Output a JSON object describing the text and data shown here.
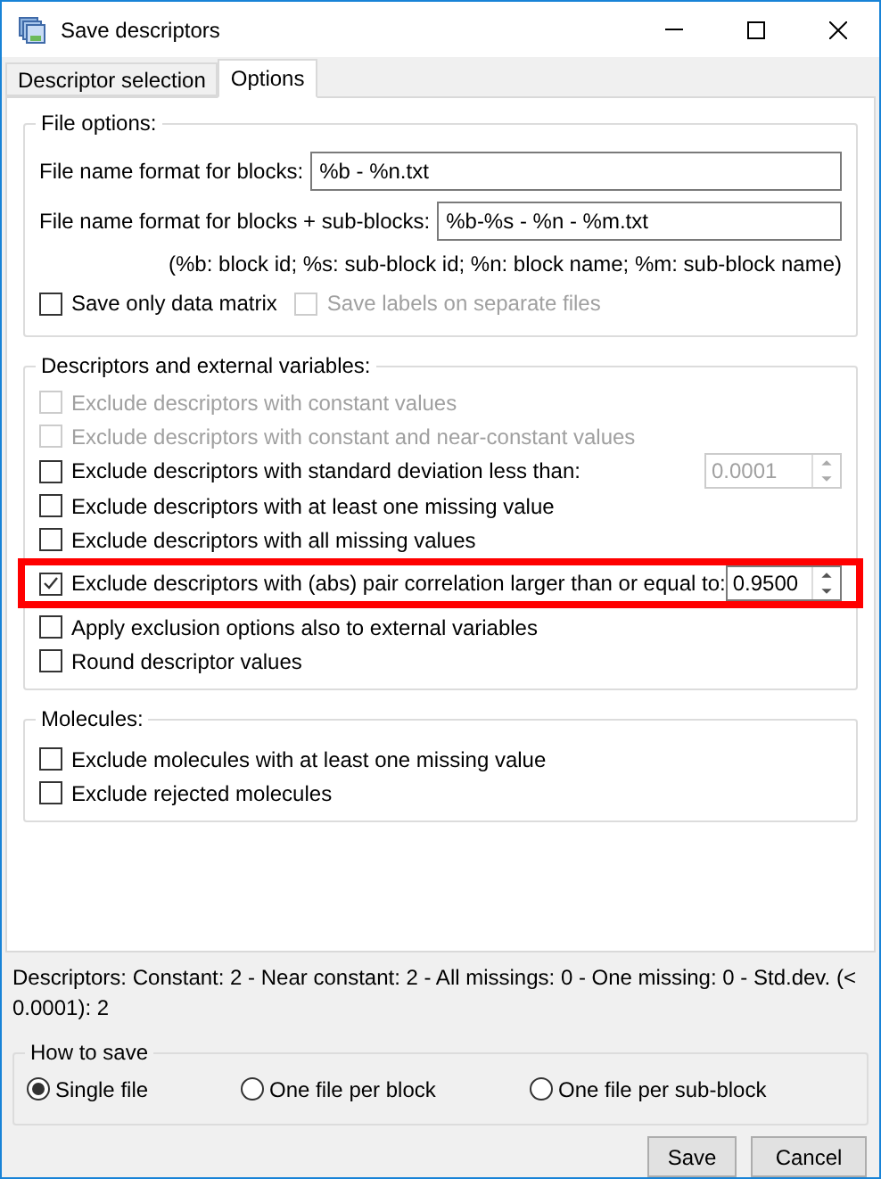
{
  "window": {
    "title": "Save descriptors"
  },
  "tabs": [
    {
      "label": "Descriptor selection",
      "selected": false
    },
    {
      "label": "Options",
      "selected": true
    }
  ],
  "file_options": {
    "title": "File options:",
    "fields": [
      {
        "label": "File name format for blocks:",
        "value": "%b - %n.txt"
      },
      {
        "label": "File name format for blocks + sub-blocks:",
        "value": "%b-%s - %n - %m.txt"
      }
    ],
    "hint": "(%b: block id; %s: sub-block id; %n: block name; %m: sub-block name)",
    "checkboxes": [
      {
        "label": "Save only data matrix",
        "checked": false,
        "disabled": false
      },
      {
        "label": "Save labels on separate files",
        "checked": false,
        "disabled": true
      }
    ]
  },
  "descriptors": {
    "title": "Descriptors and external variables:",
    "items": [
      {
        "label": "Exclude descriptors with constant values",
        "checked": false,
        "disabled": true,
        "highlighted": false
      },
      {
        "label": "Exclude descriptors with constant and near-constant values",
        "checked": false,
        "disabled": true,
        "highlighted": false
      },
      {
        "label": "Exclude descriptors with standard deviation less than:",
        "checked": false,
        "disabled": false,
        "highlighted": false,
        "spin": {
          "value": "0.0001",
          "disabled": true
        }
      },
      {
        "label": "Exclude descriptors with at least one missing value",
        "checked": false,
        "disabled": false,
        "highlighted": false
      },
      {
        "label": "Exclude descriptors with all missing values",
        "checked": false,
        "disabled": false,
        "highlighted": false
      },
      {
        "label": "Exclude descriptors with (abs) pair correlation larger than or equal to:",
        "checked": true,
        "disabled": false,
        "highlighted": true,
        "spin": {
          "value": "0.9500",
          "disabled": false
        }
      },
      {
        "label": "Apply exclusion options also to external variables",
        "checked": false,
        "disabled": false,
        "highlighted": false
      },
      {
        "label": "Round descriptor values",
        "checked": false,
        "disabled": false,
        "highlighted": false
      }
    ]
  },
  "molecules": {
    "title": "Molecules:",
    "items": [
      {
        "label": "Exclude molecules with at least one missing value",
        "checked": false,
        "disabled": false
      },
      {
        "label": "Exclude rejected molecules",
        "checked": false,
        "disabled": false
      }
    ]
  },
  "status": "Descriptors: Constant: 2 - Near constant: 2 - All missings: 0 - One missing: 0 - Std.dev. (< 0.0001): 2",
  "how_to_save": {
    "title": "How to save",
    "options": [
      {
        "label": "Single file",
        "selected": true
      },
      {
        "label": "One file per block",
        "selected": false
      },
      {
        "label": "One file per sub-block",
        "selected": false
      }
    ]
  },
  "buttons": [
    "Save",
    "Cancel"
  ]
}
